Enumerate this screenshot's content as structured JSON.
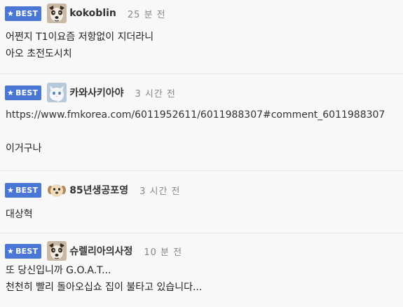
{
  "badge_label": "BEST",
  "comments": [
    {
      "nickname": "kokoblin",
      "time": "25 분 전",
      "avatar_icon": "dog-face-avatar",
      "lines": [
        "어쩐지 T1이요즘 저항없이 지더라니",
        "아오 초전도시치"
      ]
    },
    {
      "nickname": "카와사키아야",
      "time": "3 시간 전",
      "avatar_icon": "white-cat-avatar",
      "lines": [
        "https://www.fmkorea.com/6011952611/6011988307#comment_6011988307",
        "",
        "이거구나"
      ]
    },
    {
      "nickname": "85년생공포영",
      "time": "3 시간 전",
      "avatar_icon": "puppy-avatar",
      "lines": [
        "대상혁"
      ]
    },
    {
      "nickname": "슈렐리아의사정",
      "time": "10 분 전",
      "avatar_icon": "dog-face-avatar",
      "lines": [
        "또 당신입니까 G.O.A.T...",
        "천천히 빨리 돌아오십쇼 집이 불타고 있습니다..."
      ]
    }
  ],
  "colors": {
    "badge_bg": "#4a77d6",
    "background": "#f8f8f8",
    "divider": "#e2e2e2",
    "time_text": "#888888"
  }
}
